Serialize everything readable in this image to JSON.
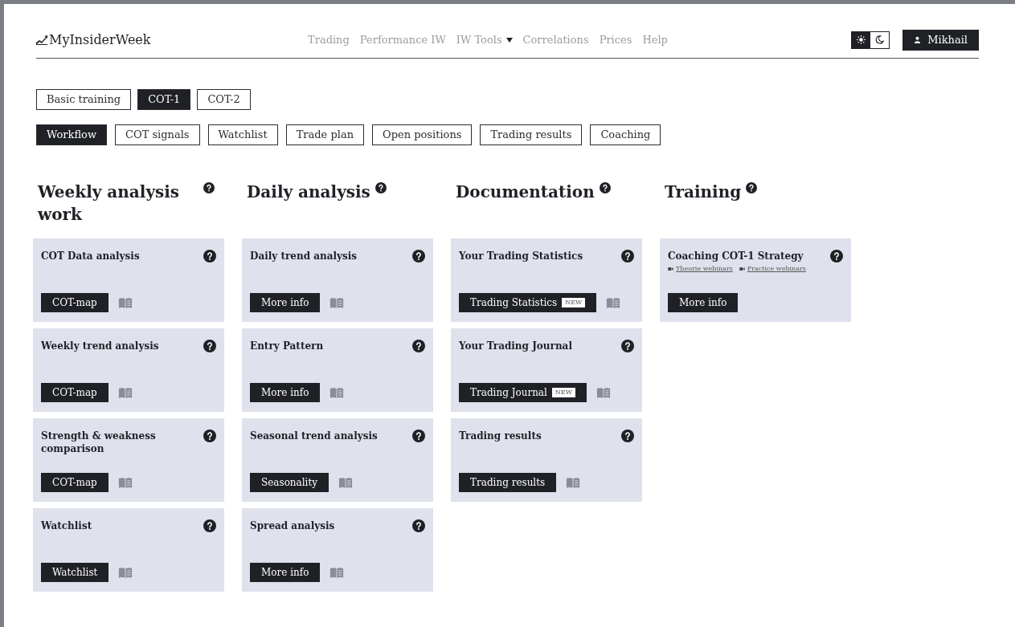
{
  "logo": {
    "text": "MyInsiderWeek"
  },
  "nav": [
    {
      "label": "Trading",
      "dropdown": false
    },
    {
      "label": "Performance IW",
      "dropdown": false
    },
    {
      "label": "IW Tools",
      "dropdown": true
    },
    {
      "label": "Correlations",
      "dropdown": false
    },
    {
      "label": "Prices",
      "dropdown": false
    },
    {
      "label": "Help",
      "dropdown": false
    }
  ],
  "theme_toggle": [
    {
      "kind": "sun",
      "selected": true
    },
    {
      "kind": "moon",
      "selected": false
    }
  ],
  "user": {
    "name": "Mikhail"
  },
  "programs": [
    {
      "label": "Basic training",
      "selected": false
    },
    {
      "label": "COT-1",
      "selected": true
    },
    {
      "label": "COT-2",
      "selected": false
    }
  ],
  "sections": [
    {
      "label": "Workflow",
      "selected": true
    },
    {
      "label": "COT signals",
      "selected": false
    },
    {
      "label": "Watchlist",
      "selected": false
    },
    {
      "label": "Trade plan",
      "selected": false
    },
    {
      "label": "Open positions",
      "selected": false
    },
    {
      "label": "Trading results",
      "selected": false
    },
    {
      "label": "Coaching",
      "selected": false
    }
  ],
  "columns": [
    {
      "title": "Weekly analysis work",
      "cards": [
        {
          "title": "COT Data analysis",
          "button": "COT-map",
          "manual": true
        },
        {
          "title": "Weekly trend analysis",
          "button": "COT-map",
          "manual": true
        },
        {
          "title": "Strength & weakness comparison",
          "button": "COT-map",
          "manual": true
        },
        {
          "title": "Watchlist",
          "button": "Watchlist",
          "manual": true
        }
      ]
    },
    {
      "title": "Daily analysis",
      "cards": [
        {
          "title": "Daily trend analysis",
          "button": "More info",
          "manual": true
        },
        {
          "title": "Entry Pattern",
          "button": "More info",
          "manual": true
        },
        {
          "title": "Seasonal trend analysis",
          "button": "Seasonality",
          "manual": true
        },
        {
          "title": "Spread analysis",
          "button": "More info",
          "manual": true
        }
      ]
    },
    {
      "title": "Documentation",
      "cards": [
        {
          "title": "Your Trading Statistics",
          "button": "Trading Statistics",
          "badge": "NEW",
          "manual": true
        },
        {
          "title": "Your Trading Journal",
          "button": "Trading Journal",
          "badge": "NEW",
          "manual": true
        },
        {
          "title": "Trading results",
          "button": "Trading results",
          "manual": true
        }
      ]
    },
    {
      "title": "Training",
      "cards": [
        {
          "title": "Coaching COT-1 Strategy",
          "links": [
            "Theorie webinars",
            "Practice webinars"
          ],
          "button": "More info",
          "manual": false
        }
      ]
    }
  ]
}
